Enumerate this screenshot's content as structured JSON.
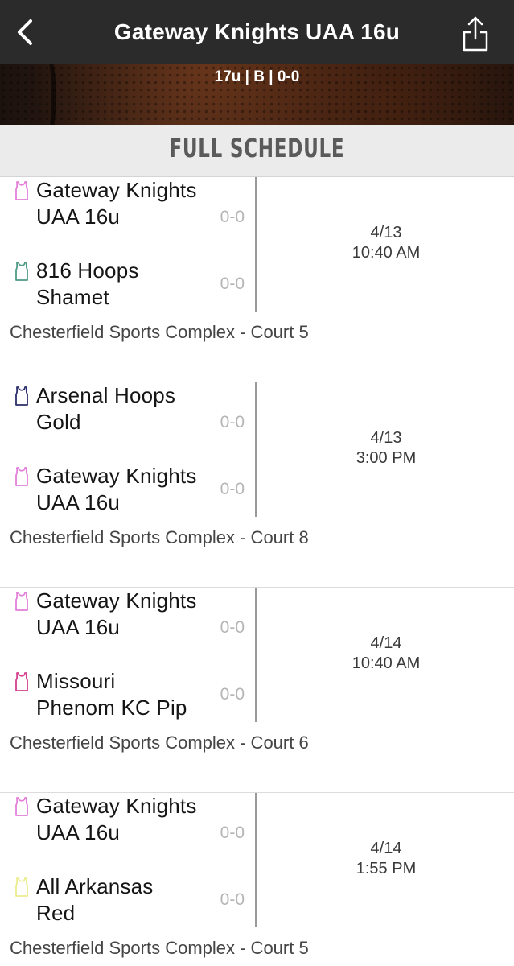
{
  "header": {
    "title": "Gateway Knights UAA 16u",
    "back_icon": "chevron-left-icon",
    "share_icon": "share-icon"
  },
  "hero": {
    "record": "17u | B | 0-0"
  },
  "section": {
    "title": "FULL SCHEDULE"
  },
  "colors": {
    "navbar": "#2b2b2b",
    "section_bg": "#ebebeb",
    "jersey_pink": "#e37fd8",
    "jersey_teal": "#4f9a86",
    "jersey_navy": "#2c2f6b",
    "jersey_magenta": "#d4408f",
    "jersey_yellow": "#ecec8e"
  },
  "games": [
    {
      "teams": [
        {
          "name": "Gateway Knights UAA 16u",
          "record": "0-0",
          "jersey_color": "#e37fd8",
          "icon": "jersey-icon"
        },
        {
          "name": "816 Hoops Shamet",
          "record": "0-0",
          "jersey_color": "#4f9a86",
          "icon": "jersey-icon"
        }
      ],
      "date": "4/13",
      "time": "10:40 AM",
      "venue": "Chesterfield Sports Complex - Court 5"
    },
    {
      "teams": [
        {
          "name": "Arsenal Hoops Gold",
          "record": "0-0",
          "jersey_color": "#2c2f6b",
          "icon": "jersey-icon"
        },
        {
          "name": "Gateway Knights UAA 16u",
          "record": "0-0",
          "jersey_color": "#e37fd8",
          "icon": "jersey-icon"
        }
      ],
      "date": "4/13",
      "time": "3:00 PM",
      "venue": "Chesterfield Sports Complex - Court 8"
    },
    {
      "teams": [
        {
          "name": "Gateway Knights UAA 16u",
          "record": "0-0",
          "jersey_color": "#e37fd8",
          "icon": "jersey-icon"
        },
        {
          "name": "Missouri Phenom KC Pip",
          "record": "0-0",
          "jersey_color": "#d4408f",
          "icon": "jersey-icon"
        }
      ],
      "date": "4/14",
      "time": "10:40 AM",
      "venue": "Chesterfield Sports Complex - Court 6"
    },
    {
      "teams": [
        {
          "name": "Gateway Knights UAA 16u",
          "record": "0-0",
          "jersey_color": "#e37fd8",
          "icon": "jersey-icon"
        },
        {
          "name": "All Arkansas Red",
          "record": "0-0",
          "jersey_color": "#ecec8e",
          "icon": "jersey-icon"
        }
      ],
      "date": "4/14",
      "time": "1:55 PM",
      "venue": "Chesterfield Sports Complex - Court 5"
    }
  ]
}
